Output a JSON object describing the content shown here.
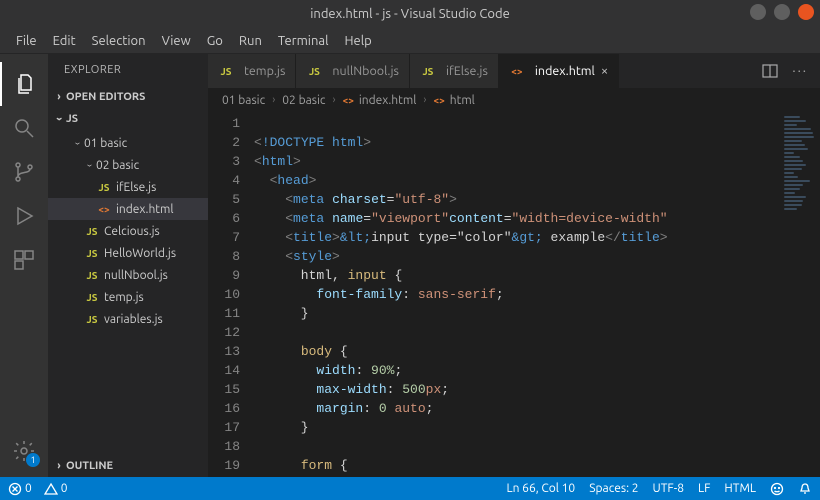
{
  "window": {
    "title": "index.html - js - Visual Studio Code"
  },
  "menu": [
    "File",
    "Edit",
    "Selection",
    "View",
    "Go",
    "Run",
    "Terminal",
    "Help"
  ],
  "activity": {
    "settings_badge": "1"
  },
  "sidebar": {
    "title": "EXPLORER",
    "open_editors": "OPEN EDITORS",
    "workspace": "JS",
    "outline": "OUTLINE",
    "tree": {
      "folder1": "01 basic",
      "folder2": "02 basic",
      "files_inner": [
        {
          "icon": "JS",
          "name": "ifElse.js"
        },
        {
          "icon": "<>",
          "name": "index.html"
        }
      ],
      "files_root": [
        {
          "icon": "JS",
          "name": "Celcious.js"
        },
        {
          "icon": "JS",
          "name": "HelloWorld.js"
        },
        {
          "icon": "JS",
          "name": "nullNbool.js"
        },
        {
          "icon": "JS",
          "name": "temp.js"
        },
        {
          "icon": "JS",
          "name": "variables.js"
        }
      ]
    }
  },
  "tabs": [
    {
      "icon": "JS",
      "label": "temp.js"
    },
    {
      "icon": "JS",
      "label": "nullNbool.js"
    },
    {
      "icon": "JS",
      "label": "ifElse.js"
    },
    {
      "icon": "<>",
      "label": "index.html"
    }
  ],
  "active_tab": 3,
  "breadcrumb": {
    "parts": [
      "01 basic",
      "02 basic",
      "index.html",
      "html"
    ],
    "icons": [
      "",
      "",
      "<>",
      "<>"
    ]
  },
  "code": {
    "first_line": 1,
    "lines": [
      "",
      "<!DOCTYPE html>",
      "<html>",
      "  <head>",
      "    <meta charset=\"utf-8\">",
      "    <meta name=\"viewport\" content=\"width=device-width\"",
      "    <title>&lt;input type=\"color\"&gt; example</title>",
      "    <style>",
      "      html, input {",
      "        font-family: sans-serif;",
      "      }",
      "",
      "      body {",
      "        width: 90%;",
      "        max-width: 500px;",
      "        margin: 0 auto;",
      "      }",
      "",
      "      form {"
    ]
  },
  "status": {
    "errors": "0",
    "warnings": "0",
    "cursor": "Ln 66, Col 10",
    "spaces": "Spaces: 2",
    "encoding": "UTF-8",
    "eol": "LF",
    "lang": "HTML"
  }
}
